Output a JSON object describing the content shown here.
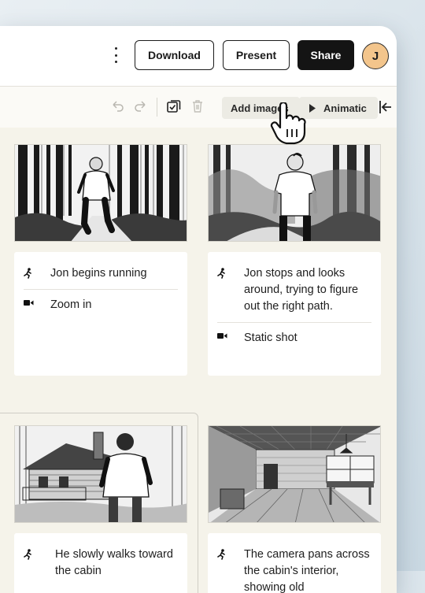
{
  "header": {
    "more_icon": "kebab-vertical-icon",
    "download_label": "Download",
    "present_label": "Present",
    "share_label": "Share",
    "avatar_initial": "J"
  },
  "toolbar": {
    "icons": [
      "undo-icon",
      "redo-icon",
      "select-all-icon",
      "delete-icon",
      "collapse-panel-icon"
    ],
    "add_images_label": "Add images",
    "animatic_label": "Animatic"
  },
  "storyboard": {
    "frames": [
      {
        "image": "man-running-through-forest-sketch",
        "notes": [
          {
            "icon": "action-running-icon",
            "text": "Jon begins running"
          },
          {
            "icon": "camera-icon",
            "text": "Zoom in"
          }
        ]
      },
      {
        "image": "man-standing-on-forest-path-sketch",
        "notes": [
          {
            "icon": "action-running-icon",
            "text": "Jon stops and looks around, trying to figure out the right path."
          },
          {
            "icon": "camera-icon",
            "text": "Static shot"
          }
        ]
      },
      {
        "image": "man-walking-toward-cabin-sketch",
        "notes": [
          {
            "icon": "action-running-icon",
            "text": "He slowly walks toward the cabin"
          }
        ]
      },
      {
        "image": "cabin-interior-sketch",
        "notes": [
          {
            "icon": "action-running-icon",
            "text": "The camera pans across the cabin's interior, showing old"
          }
        ]
      }
    ]
  },
  "colors": {
    "accent_avatar": "#f3c58c",
    "dark_button": "#141414",
    "panel_background": "#f5f3ea"
  }
}
